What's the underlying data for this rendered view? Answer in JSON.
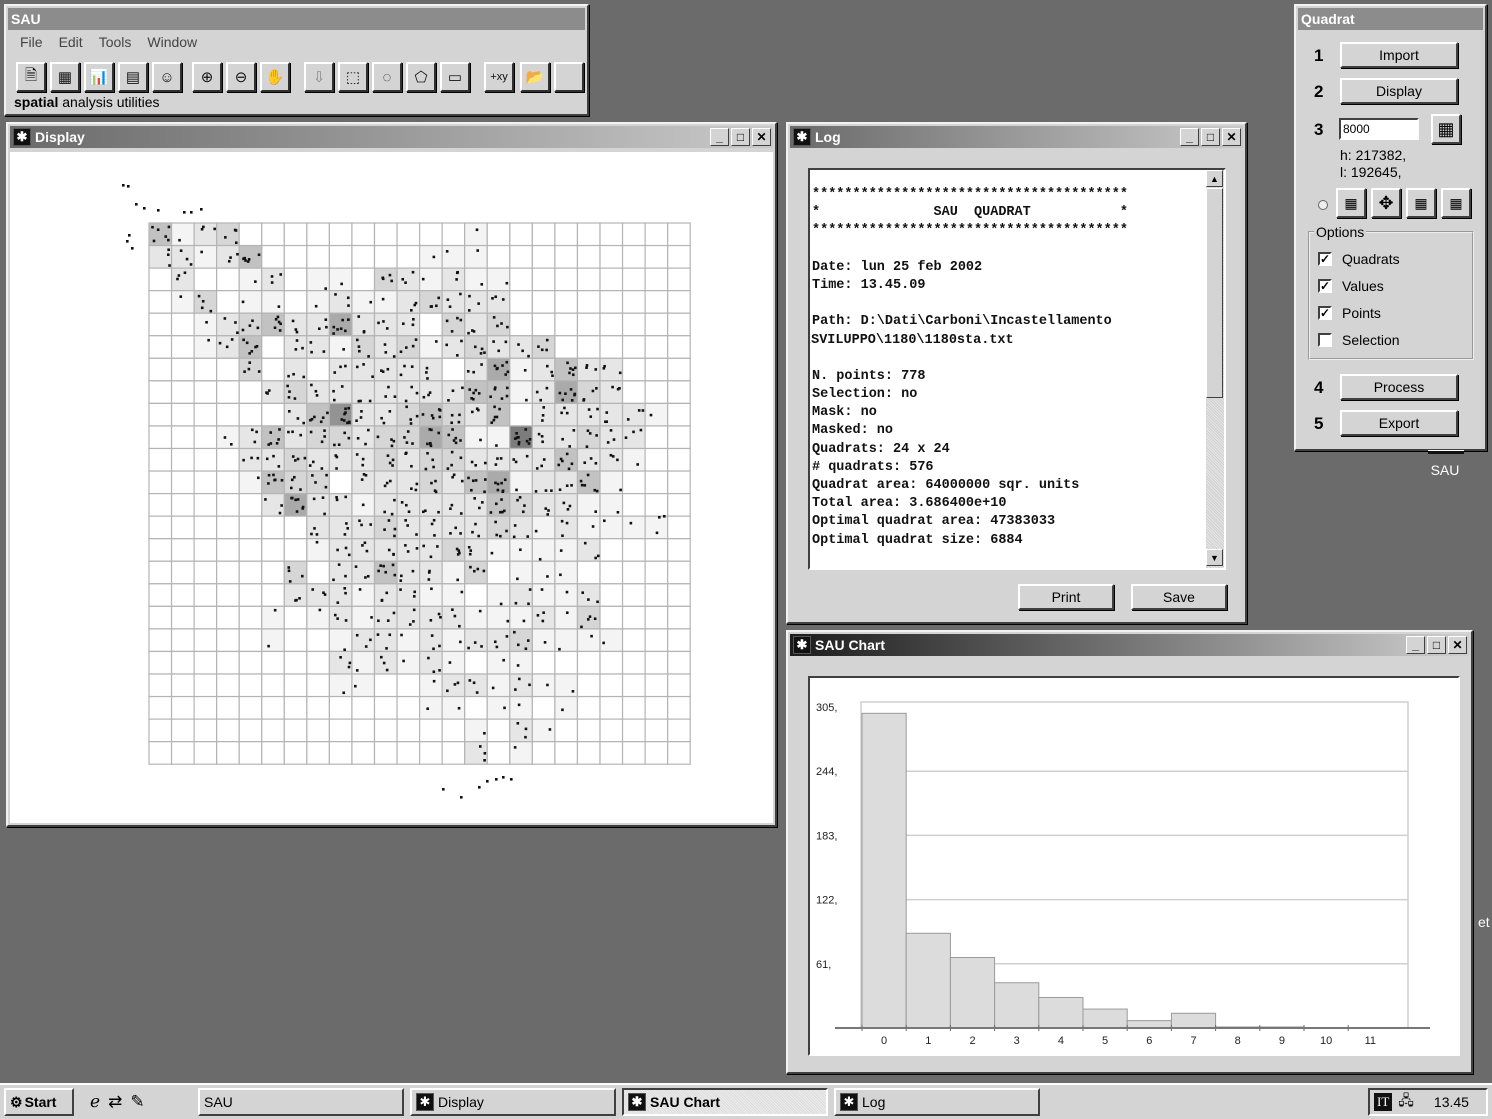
{
  "main_window": {
    "title": "SAU",
    "menu": [
      "File",
      "Edit",
      "Tools",
      "Window"
    ],
    "tagline_bold": "spatial",
    "tagline_rest": " analysis utilities",
    "toolbar": [
      {
        "name": "new-doc-icon",
        "glyph": "🗎",
        "enabled": true
      },
      {
        "name": "points-map-icon",
        "glyph": "▦",
        "enabled": true
      },
      {
        "name": "bar-chart-icon",
        "glyph": "📊",
        "enabled": true
      },
      {
        "name": "table-icon",
        "glyph": "▤",
        "enabled": true
      },
      {
        "name": "mask-icon",
        "glyph": "☺",
        "enabled": true
      },
      {
        "name": "zoom-in-icon",
        "glyph": "⊕",
        "enabled": true
      },
      {
        "name": "zoom-out-icon",
        "glyph": "⊖",
        "enabled": true
      },
      {
        "name": "pan-hand-icon",
        "glyph": "✋",
        "enabled": false
      },
      {
        "name": "import-selection-icon",
        "glyph": "⇩",
        "enabled": false
      },
      {
        "name": "rect-select-icon",
        "glyph": "⬚",
        "enabled": true
      },
      {
        "name": "circle-select-icon",
        "glyph": "◌",
        "enabled": true
      },
      {
        "name": "poly-select-icon",
        "glyph": "⬠",
        "enabled": true
      },
      {
        "name": "open-selection-icon",
        "glyph": "▭",
        "enabled": true
      },
      {
        "name": "coordinates-icon",
        "glyph": "+xy",
        "enabled": true
      },
      {
        "name": "open-folder-icon",
        "glyph": "📂",
        "enabled": false
      },
      {
        "name": "blank-icon",
        "glyph": "",
        "enabled": false
      }
    ]
  },
  "display_window": {
    "title": "Display",
    "grid": {
      "rows": 24,
      "cols": 24,
      "counts": [
        [
          4,
          1,
          2,
          3,
          0,
          0,
          0,
          0,
          0,
          0,
          0,
          0,
          0,
          0,
          1,
          0,
          0,
          0,
          0,
          0,
          0,
          0,
          0,
          0
        ],
        [
          2,
          2,
          1,
          2,
          4,
          0,
          0,
          0,
          0,
          0,
          0,
          0,
          1,
          1,
          1,
          0,
          0,
          0,
          0,
          0,
          0,
          0,
          0,
          0
        ],
        [
          0,
          2,
          0,
          0,
          1,
          2,
          0,
          1,
          1,
          0,
          3,
          2,
          1,
          2,
          1,
          1,
          0,
          0,
          0,
          0,
          0,
          0,
          0,
          0
        ],
        [
          0,
          1,
          3,
          0,
          1,
          1,
          0,
          1,
          2,
          1,
          1,
          2,
          3,
          2,
          2,
          2,
          0,
          0,
          0,
          0,
          0,
          0,
          0,
          0
        ],
        [
          0,
          0,
          1,
          2,
          3,
          4,
          2,
          2,
          5,
          2,
          2,
          2,
          0,
          3,
          2,
          3,
          0,
          0,
          0,
          0,
          0,
          0,
          0,
          0
        ],
        [
          0,
          0,
          1,
          2,
          4,
          0,
          2,
          2,
          1,
          3,
          2,
          3,
          1,
          2,
          3,
          2,
          2,
          3,
          0,
          0,
          0,
          0,
          0,
          0
        ],
        [
          0,
          0,
          0,
          0,
          3,
          0,
          2,
          0,
          2,
          2,
          2,
          2,
          2,
          0,
          2,
          5,
          1,
          2,
          4,
          2,
          2,
          0,
          0,
          0
        ],
        [
          0,
          0,
          0,
          0,
          0,
          2,
          3,
          2,
          2,
          2,
          2,
          2,
          2,
          2,
          4,
          4,
          1,
          2,
          5,
          3,
          2,
          0,
          0,
          0
        ],
        [
          0,
          0,
          0,
          0,
          0,
          0,
          2,
          4,
          6,
          2,
          2,
          3,
          4,
          3,
          2,
          4,
          0,
          2,
          2,
          2,
          2,
          2,
          1,
          0
        ],
        [
          0,
          0,
          0,
          1,
          2,
          4,
          2,
          3,
          3,
          2,
          3,
          3,
          5,
          4,
          1,
          1,
          7,
          2,
          2,
          3,
          2,
          2,
          0,
          0
        ],
        [
          0,
          0,
          0,
          0,
          2,
          2,
          3,
          2,
          2,
          2,
          3,
          2,
          3,
          3,
          2,
          2,
          2,
          2,
          4,
          2,
          2,
          1,
          0,
          0
        ],
        [
          0,
          0,
          0,
          0,
          1,
          4,
          3,
          3,
          0,
          2,
          2,
          2,
          3,
          2,
          4,
          5,
          1,
          2,
          2,
          4,
          1,
          0,
          0,
          0
        ],
        [
          0,
          0,
          0,
          0,
          0,
          2,
          5,
          2,
          2,
          1,
          2,
          2,
          2,
          2,
          2,
          4,
          3,
          2,
          2,
          1,
          1,
          0,
          0,
          0
        ],
        [
          0,
          0,
          0,
          0,
          0,
          0,
          0,
          2,
          2,
          2,
          3,
          2,
          2,
          2,
          2,
          3,
          2,
          1,
          2,
          1,
          1,
          1,
          1,
          0
        ],
        [
          0,
          0,
          0,
          0,
          0,
          0,
          0,
          1,
          2,
          2,
          2,
          2,
          2,
          3,
          2,
          1,
          1,
          1,
          1,
          2,
          0,
          0,
          0,
          0
        ],
        [
          0,
          0,
          0,
          0,
          0,
          0,
          3,
          0,
          2,
          2,
          4,
          2,
          2,
          1,
          3,
          0,
          1,
          1,
          1,
          0,
          0,
          0,
          0,
          0
        ],
        [
          0,
          0,
          0,
          0,
          0,
          0,
          2,
          2,
          2,
          1,
          2,
          2,
          1,
          1,
          0,
          1,
          2,
          1,
          1,
          2,
          0,
          0,
          0,
          0
        ],
        [
          0,
          0,
          0,
          0,
          0,
          1,
          0,
          1,
          2,
          1,
          2,
          2,
          2,
          2,
          1,
          1,
          1,
          2,
          1,
          3,
          0,
          0,
          0,
          0
        ],
        [
          0,
          0,
          0,
          0,
          0,
          1,
          0,
          0,
          1,
          2,
          2,
          1,
          2,
          1,
          2,
          2,
          3,
          1,
          1,
          1,
          1,
          0,
          0,
          0
        ],
        [
          0,
          0,
          0,
          0,
          0,
          0,
          0,
          0,
          2,
          1,
          2,
          1,
          2,
          1,
          0,
          1,
          1,
          0,
          0,
          0,
          0,
          0,
          0,
          0
        ],
        [
          0,
          0,
          0,
          0,
          0,
          0,
          0,
          0,
          1,
          1,
          0,
          0,
          1,
          2,
          2,
          1,
          2,
          1,
          1,
          0,
          0,
          0,
          0,
          0
        ],
        [
          0,
          0,
          0,
          0,
          0,
          0,
          0,
          0,
          0,
          0,
          0,
          0,
          1,
          1,
          0,
          1,
          1,
          0,
          1,
          0,
          0,
          0,
          0,
          0
        ],
        [
          0,
          0,
          0,
          0,
          0,
          0,
          0,
          0,
          0,
          0,
          0,
          0,
          0,
          0,
          1,
          0,
          2,
          1,
          0,
          0,
          0,
          0,
          0,
          0
        ],
        [
          0,
          0,
          0,
          0,
          0,
          0,
          0,
          0,
          0,
          0,
          0,
          0,
          0,
          0,
          2,
          0,
          1,
          0,
          0,
          0,
          0,
          0,
          0,
          0
        ]
      ]
    }
  },
  "log_window": {
    "title": "Log",
    "lines": [
      "***************************************",
      "*              SAU  QUADRAT           *",
      "***************************************",
      "",
      "Date: lun 25 feb 2002",
      "Time: 13.45.09",
      "",
      "Path: D:\\Dati\\Carboni\\Incastellamento",
      "\\SVILUPPO\\1180\\1180sta.txt",
      "",
      "N. points: 778",
      "Selection: no",
      "Mask: no",
      "Masked: no",
      "Quadrats: 24 x 24",
      "# quadrats: 576",
      "Quadrat area: 64000000 sqr. units",
      "Total area: 3.686400e+10",
      "Optimal quadrat area: 47383033",
      "Optimal quadrat size: 6884"
    ],
    "print_label": "Print",
    "save_label": "Save"
  },
  "quadrat_panel": {
    "title": "Quadrat",
    "steps": {
      "s1": "1",
      "s2": "2",
      "s3": "3",
      "s4": "4",
      "s5": "5"
    },
    "import_label": "Import",
    "display_label": "Display",
    "size_value": "8000",
    "h_text": "h: 217382,",
    "l_text": "l: 192645,",
    "options_title": "Options",
    "options": [
      {
        "label": "Quadrats",
        "checked": true
      },
      {
        "label": "Values",
        "checked": true
      },
      {
        "label": "Points",
        "checked": true
      },
      {
        "label": "Selection",
        "checked": false
      }
    ],
    "process_label": "Process",
    "export_label": "Export"
  },
  "desktop": {
    "icon_label": "SAU",
    "edge_text": "et"
  },
  "chart_window": {
    "title": "SAU Chart"
  },
  "chart_data": {
    "type": "bar",
    "title": "",
    "xlabel": "",
    "ylabel": "",
    "categories": [
      "0",
      "1",
      "2",
      "3",
      "4",
      "5",
      "6",
      "7",
      "8",
      "9",
      "10",
      "11"
    ],
    "values": [
      299,
      90,
      67,
      43,
      29,
      18,
      7,
      14,
      1,
      1,
      0,
      0
    ],
    "yticks": [
      61,
      122,
      183,
      244,
      305
    ],
    "ytick_labels": [
      "61,",
      "122,",
      "183,",
      "244,",
      "305,"
    ],
    "ylim": [
      0,
      305
    ],
    "grid": true,
    "legend": "none",
    "bar_color": "#dcdcdc"
  },
  "taskbar": {
    "start_label": "Start",
    "tasks": [
      {
        "label": "SAU",
        "icon": false,
        "active": false
      },
      {
        "label": "Display",
        "icon": true,
        "active": false
      },
      {
        "label": "SAU Chart",
        "icon": true,
        "active": true
      },
      {
        "label": "Log",
        "icon": true,
        "active": false
      }
    ],
    "lang": "IT",
    "clock": "13.45"
  }
}
